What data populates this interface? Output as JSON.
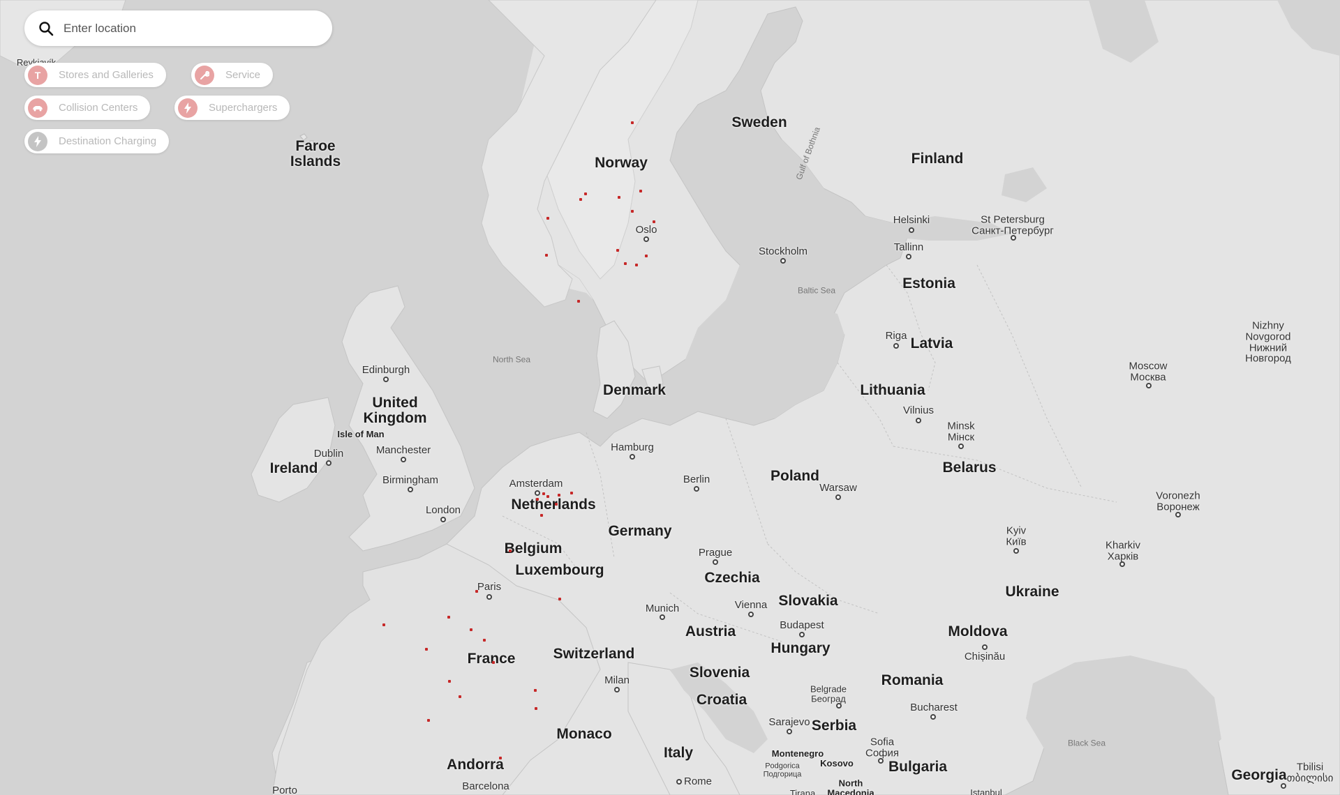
{
  "search": {
    "placeholder": "Enter location",
    "icon": "search-icon"
  },
  "filters": [
    {
      "label": "Stores and Galleries",
      "icon": "tesla-t-icon",
      "color": "#e8a3a3"
    },
    {
      "label": "Service",
      "icon": "wrench-icon",
      "color": "#e8a3a3"
    },
    {
      "label": "Collision Centers",
      "icon": "car-icon",
      "color": "#e8a3a3"
    },
    {
      "label": "Superchargers",
      "icon": "bolt-icon",
      "color": "#e8a3a3"
    },
    {
      "label": "Destination Charging",
      "icon": "bolt-icon",
      "color": "#c4c4c4"
    }
  ],
  "map": {
    "countries": {
      "sweden": "Sweden",
      "norway": "Norway",
      "finland": "Finland",
      "faroe": "Faroe\nIslands",
      "estonia": "Estonia",
      "latvia": "Latvia",
      "lithuania": "Lithuania",
      "denmark": "Denmark",
      "uk": "United\nKingdom",
      "ireland": "Ireland",
      "netherlands": "Netherlands",
      "belgium": "Belgium",
      "luxembourg": "Luxembourg",
      "germany": "Germany",
      "poland": "Poland",
      "belarus": "Belarus",
      "czechia": "Czechia",
      "slovakia": "Slovakia",
      "austria": "Austria",
      "hungary": "Hungary",
      "ukraine": "Ukraine",
      "moldova": "Moldova",
      "romania": "Romania",
      "switzerland": "Switzerland",
      "france": "France",
      "slovenia": "Slovenia",
      "croatia": "Croatia",
      "serbia": "Serbia",
      "monaco": "Monaco",
      "italy": "Italy",
      "andorra": "Andorra",
      "bulgaria": "Bulgaria",
      "georgia": "Georgia"
    },
    "cities": {
      "reykjavik": "Reykjavík",
      "oslo": "Oslo",
      "stockholm": "Stockholm",
      "helsinki": "Helsinki",
      "stpetersburg": "St Petersburg\nСанкт-Петербург",
      "tallinn": "Tallinn",
      "riga": "Riga",
      "vilnius": "Vilnius",
      "minsk": "Minsk\nМінск",
      "moscow": "Moscow\nМосква",
      "nizhny": "Nizhny\nNovgorod\nНижний\nНовгород",
      "edinburgh": "Edinburgh",
      "isleofman": "Isle of Man",
      "dublin": "Dublin",
      "manchester": "Manchester",
      "birmingham": "Birmingham",
      "london": "London",
      "amsterdam": "Amsterdam",
      "hamburg": "Hamburg",
      "berlin": "Berlin",
      "warsaw": "Warsaw",
      "voronezh": "Voronezh\nВоронеж",
      "kyiv": "Kyiv\nКиїв",
      "kharkiv": "Kharkiv\nХарків",
      "prague": "Prague",
      "paris": "Paris",
      "munich": "Munich",
      "vienna": "Vienna",
      "budapest": "Budapest",
      "chisinau": "Chișinău",
      "milan": "Milan",
      "belgrade": "Belgrade\nБеоград",
      "bucharest": "Bucharest",
      "sarajevo": "Sarajevo",
      "montenegro": "Montenegro",
      "podgorica": "Podgorica\nПодгорица",
      "kosovo": "Kosovo",
      "sofia": "Sofia\nСофия",
      "rome": "Rome",
      "barcelona": "Barcelona",
      "porto": "Porto",
      "northmacedonia": "North\nMacedonia",
      "tbilisi": "Tbilisi\nთბილისი",
      "tirana": "Tirana",
      "istanbul": "Istanbul"
    },
    "waters": {
      "northsea": "North Sea",
      "balticsea": "Baltic Sea",
      "gulfbothnia": "Gulf of Bothnia",
      "blacksea": "Black Sea"
    }
  }
}
